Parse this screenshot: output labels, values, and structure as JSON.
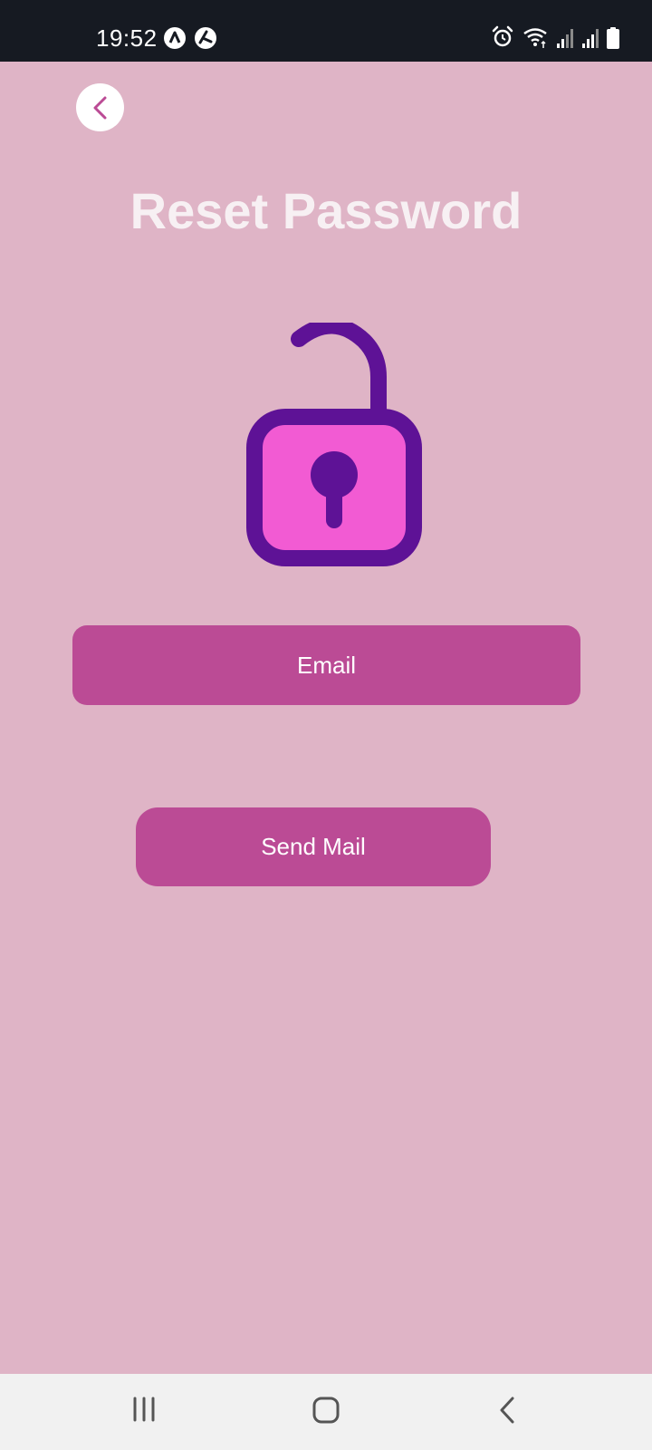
{
  "status_bar": {
    "time": "19:52",
    "left_icons": [
      "notification-a-icon",
      "notification-b-icon"
    ],
    "right_icons": [
      "alarm-icon",
      "wifi-icon",
      "signal-icon",
      "signal-icon",
      "battery-icon"
    ]
  },
  "header": {
    "back_icon": "chevron-left-icon",
    "title": "Reset Password"
  },
  "illustration": {
    "name": "unlocked-padlock-icon",
    "colors": {
      "outline": "#5e1296",
      "fill": "#f25bd3"
    }
  },
  "form": {
    "email_placeholder": "Email",
    "email_value": "",
    "send_label": "Send Mail"
  },
  "nav_bar": {
    "buttons": [
      "recents-icon",
      "home-icon",
      "back-icon"
    ]
  },
  "colors": {
    "background": "#dfb4c6",
    "accent": "#bb4b95",
    "status_bar": "#161a22",
    "nav_bar": "#f1f1f1"
  }
}
